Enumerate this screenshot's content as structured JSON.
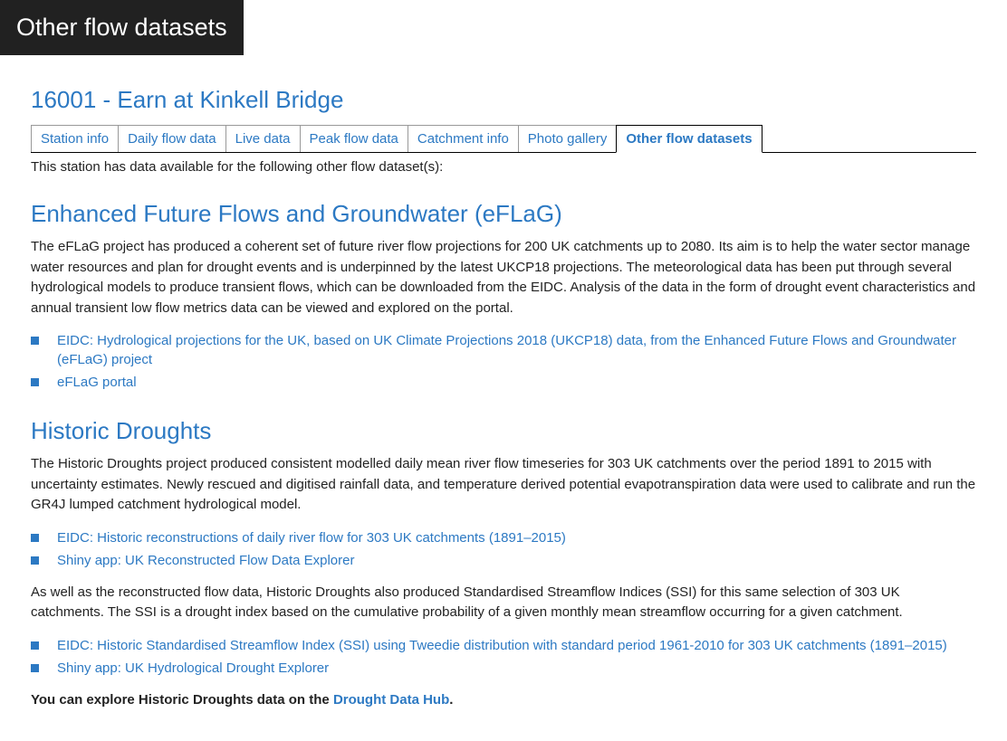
{
  "header_badge": "Other flow datasets",
  "page_title": "16001 - Earn at Kinkell Bridge",
  "tabs": [
    {
      "label": "Station info"
    },
    {
      "label": "Daily flow data"
    },
    {
      "label": "Live data"
    },
    {
      "label": "Peak flow data"
    },
    {
      "label": "Catchment info"
    },
    {
      "label": "Photo gallery"
    },
    {
      "label": "Other flow datasets"
    }
  ],
  "intro": "This station has data available for the following other flow dataset(s):",
  "eflag": {
    "title": "Enhanced Future Flows and Groundwater (eFLaG)",
    "body": "The eFLaG project has produced a coherent set of future river flow projections for 200 UK catchments up to 2080. Its aim is to help the water sector manage water resources and plan for drought events and is underpinned by the latest UKCP18 projections. The meteorological data has been put through several hydrological models to produce transient flows, which can be downloaded from the EIDC. Analysis of the data in the form of drought event characteristics and annual transient low flow metrics data can be viewed and explored on the portal.",
    "links": [
      "EIDC: Hydrological projections for the UK, based on UK Climate Projections 2018 (UKCP18) data, from the Enhanced Future Flows and Groundwater (eFLaG) project",
      "eFLaG portal"
    ]
  },
  "historic": {
    "title": "Historic Droughts",
    "body1": "The Historic Droughts project produced consistent modelled daily mean river flow timeseries for 303 UK catchments over the period 1891 to 2015 with uncertainty estimates. Newly rescued and digitised rainfall data, and temperature derived potential evapotranspiration data were used to calibrate and run the GR4J lumped catchment hydrological model.",
    "links1": [
      "EIDC: Historic reconstructions of daily river flow for 303 UK catchments (1891–2015)",
      "Shiny app: UK Reconstructed Flow Data Explorer"
    ],
    "body2": "As well as the reconstructed flow data, Historic Droughts also produced Standardised Streamflow Indices (SSI) for this same selection of 303 UK catchments. The SSI is a drought index based on the cumulative probability of a given monthly mean streamflow occurring for a given catchment.",
    "links2": [
      "EIDC: Historic Standardised Streamflow Index (SSI) using Tweedie distribution with standard period 1961-2010 for 303 UK catchments (1891–2015)",
      "Shiny app: UK Hydrological Drought Explorer"
    ],
    "final_prefix": "You can explore Historic Droughts data on the ",
    "final_link": "Drought Data Hub",
    "final_suffix": "."
  }
}
